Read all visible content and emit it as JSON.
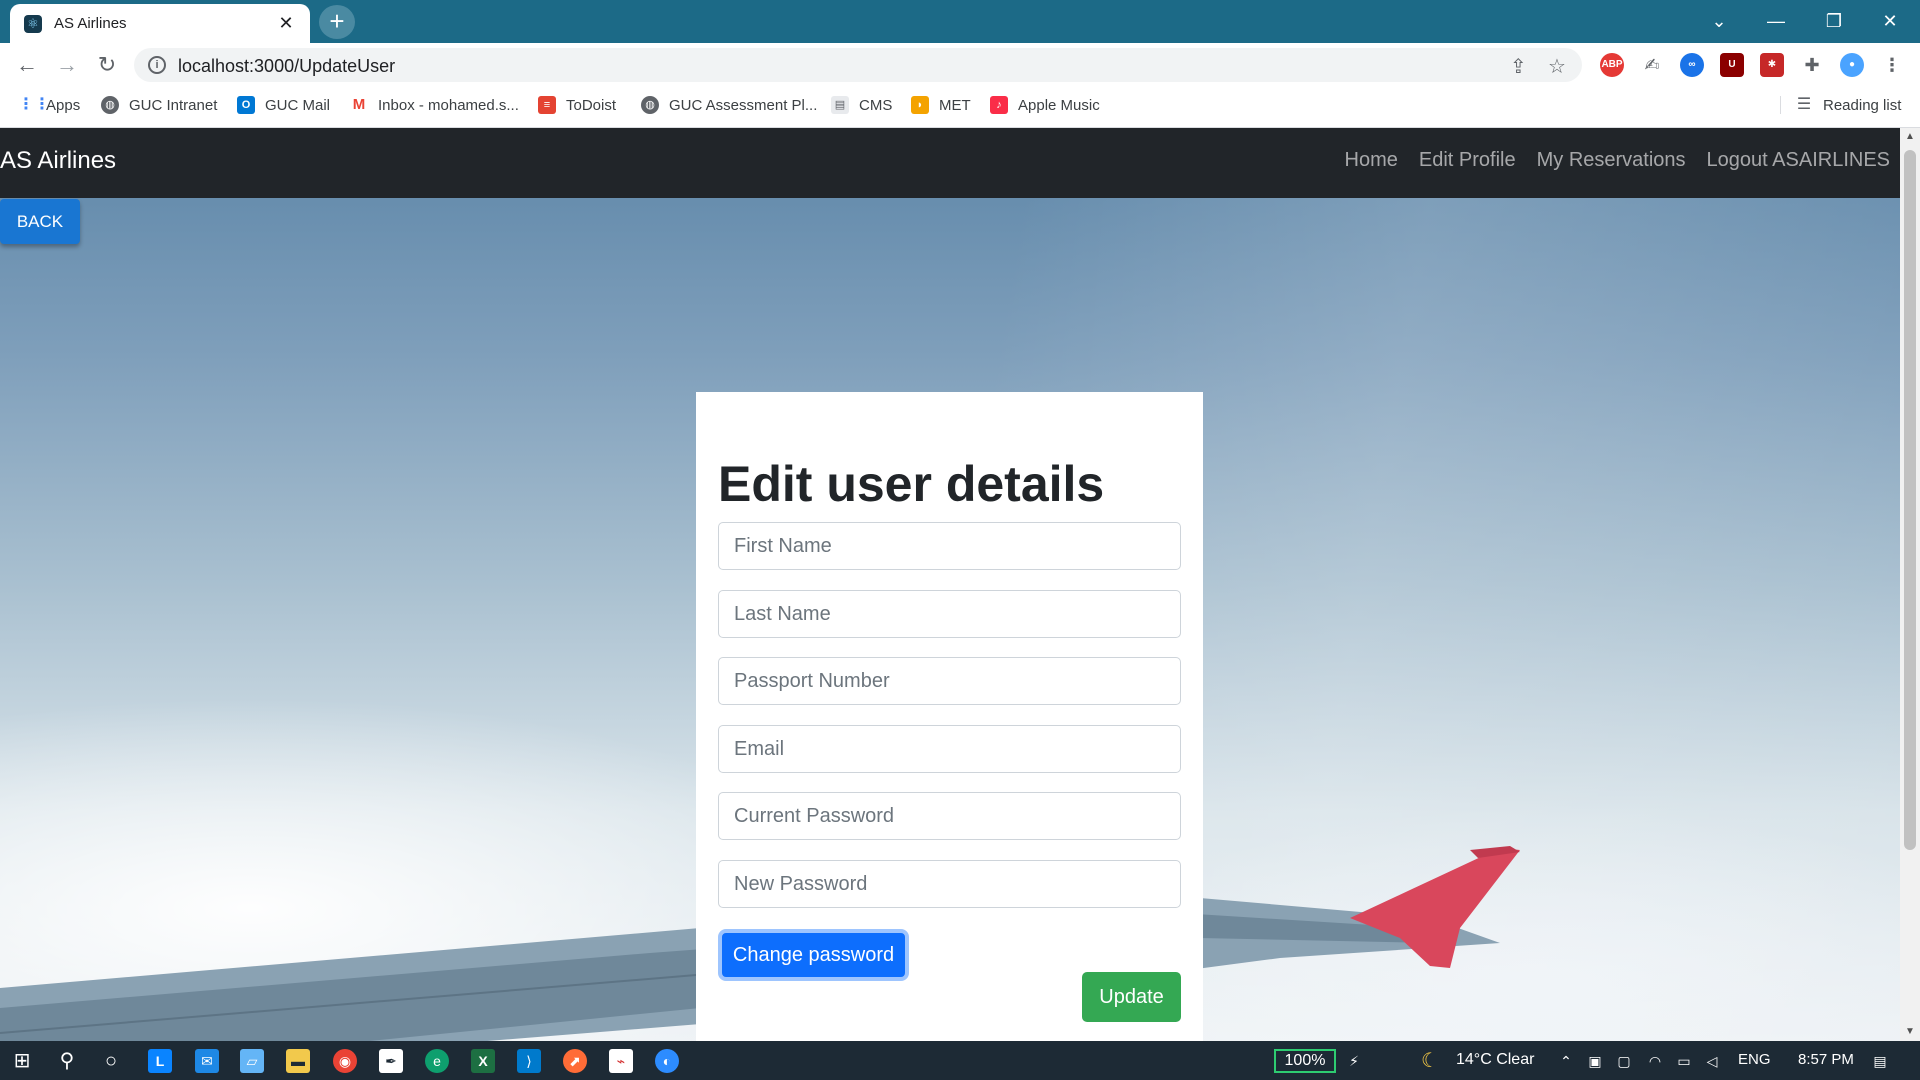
{
  "browser": {
    "tab_title": "AS Airlines",
    "tab_close": "✕",
    "new_tab": "+",
    "url": "localhost:3000/UpdateUser",
    "window_controls": {
      "dropdown": "⌄",
      "minimize": "—",
      "restore": "❐",
      "close": "✕"
    },
    "extensions": [
      "ABP",
      "ext-2",
      "ext-3",
      "uBlock",
      "ext-5",
      "puzzle-icon",
      "profile"
    ],
    "bookmarks": [
      {
        "label": "Apps",
        "icon": "apps-grid-icon"
      },
      {
        "label": "GUC Intranet",
        "icon": "globe-icon"
      },
      {
        "label": "GUC Mail",
        "icon": "outlook-icon"
      },
      {
        "label": "Inbox - mohamed.s...",
        "icon": "gmail-icon"
      },
      {
        "label": "ToDoist",
        "icon": "todoist-icon"
      },
      {
        "label": "GUC Assessment Pl...",
        "icon": "globe-icon"
      },
      {
        "label": "CMS",
        "icon": "document-icon"
      },
      {
        "label": "MET",
        "icon": "met-icon"
      },
      {
        "label": "Apple Music",
        "icon": "music-icon"
      }
    ],
    "reading_list": "Reading list"
  },
  "navbar": {
    "brand": "AS Airlines",
    "links": [
      "Home",
      "Edit Profile",
      "My Reservations",
      "Logout ASAIRLINES"
    ]
  },
  "back_button": "BACK",
  "form": {
    "title": "Edit user details",
    "fields": [
      {
        "placeholder": "First Name",
        "value": ""
      },
      {
        "placeholder": "Last Name",
        "value": ""
      },
      {
        "placeholder": "Passport Number",
        "value": ""
      },
      {
        "placeholder": "Email",
        "value": ""
      },
      {
        "placeholder": "Current Password",
        "value": ""
      },
      {
        "placeholder": "New Password",
        "value": ""
      }
    ],
    "change_password_label": "Change password",
    "update_label": "Update"
  },
  "taskbar": {
    "battery": "100%",
    "weather": "14°C  Clear",
    "language": "ENG",
    "time": "8:57 PM"
  },
  "colors": {
    "navbar_bg": "#212529",
    "primary": "#0d6efd",
    "success": "#34a853",
    "back_button": "#1976d2",
    "chrome_title": "#1c6a87"
  }
}
